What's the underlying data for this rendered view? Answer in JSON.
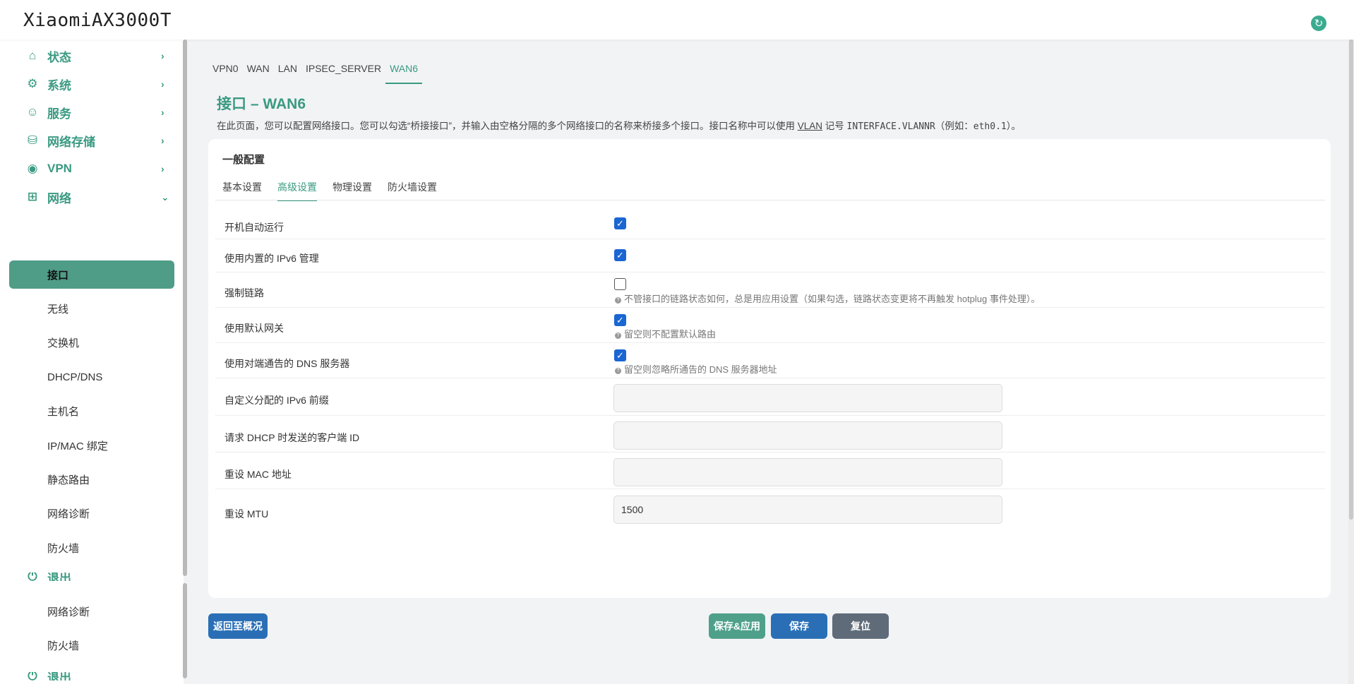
{
  "header": {
    "brand": "XiaomiAX3000T",
    "refresh_icon": "↻"
  },
  "sidebar": {
    "menus": [
      {
        "label": "状态",
        "icon": "⌂",
        "chevron": "›"
      },
      {
        "label": "系统",
        "icon": "⚙",
        "chevron": "›"
      },
      {
        "label": "服务",
        "icon": "☺",
        "chevron": "›"
      },
      {
        "label": "网络存储",
        "icon": "⛁",
        "chevron": "›"
      },
      {
        "label": "VPN",
        "icon": "◉",
        "chevron": "›"
      },
      {
        "label": "网络",
        "icon": "⊞",
        "chevron": "⌄"
      }
    ],
    "network_sub": [
      "接口",
      "无线",
      "交换机",
      "DHCP/DNS",
      "主机名",
      "IP/MAC 绑定",
      "静态路由",
      "网络诊断",
      "防火墙"
    ],
    "logout": "退出",
    "extra_sub": [
      "网络诊断",
      "防火墙"
    ],
    "logout2": "退出"
  },
  "main": {
    "tabs": [
      "VPN0",
      "WAN",
      "LAN",
      "IPSEC_SERVER",
      "WAN6"
    ],
    "title": "接口 – WAN6",
    "desc_pre": "在此页面，您可以配置网络接口。您可以勾选“桥接接口”，并输入由空格分隔的多个网络接口的名称来桥接多个接口。接口名称中可以使用 ",
    "desc_vlan": "VLAN",
    "desc_mid": " 记号 ",
    "desc_code1": "INTERFACE.VLANNR",
    "desc_post1": "（例如：",
    "desc_code2": "eth0.1",
    "desc_post2": "）。",
    "section_title": "一般配置",
    "subtabs": [
      "基本设置",
      "高级设置",
      "物理设置",
      "防火墙设置"
    ],
    "rows": {
      "autostart": {
        "label": "开机自动运行",
        "checked": true
      },
      "ipv6": {
        "label": "使用内置的 IPv6 管理",
        "checked": true
      },
      "force_link": {
        "label": "强制链路",
        "checked": false,
        "hint": "不管接口的链路状态如何，总是用应用设置（如果勾选，链路状态变更将不再触发 hotplug 事件处理）。"
      },
      "default_gw": {
        "label": "使用默认网关",
        "checked": true,
        "hint": "留空则不配置默认路由"
      },
      "peer_dns": {
        "label": "使用对端通告的 DNS 服务器",
        "checked": true,
        "hint": "留空则忽略所通告的 DNS 服务器地址"
      },
      "ip6prefix": {
        "label": "自定义分配的 IPv6 前缀",
        "value": ""
      },
      "clientid": {
        "label": "请求 DHCP 时发送的客户端 ID",
        "value": ""
      },
      "macaddr": {
        "label": "重设 MAC 地址",
        "value": ""
      },
      "mtu": {
        "label": "重设 MTU",
        "value": "1500"
      }
    },
    "check_glyph": "✓",
    "hint_glyph": "?"
  },
  "buttons": {
    "back": "返回至概况",
    "save_apply": "保存&应用",
    "save": "保存",
    "reset": "复位"
  }
}
